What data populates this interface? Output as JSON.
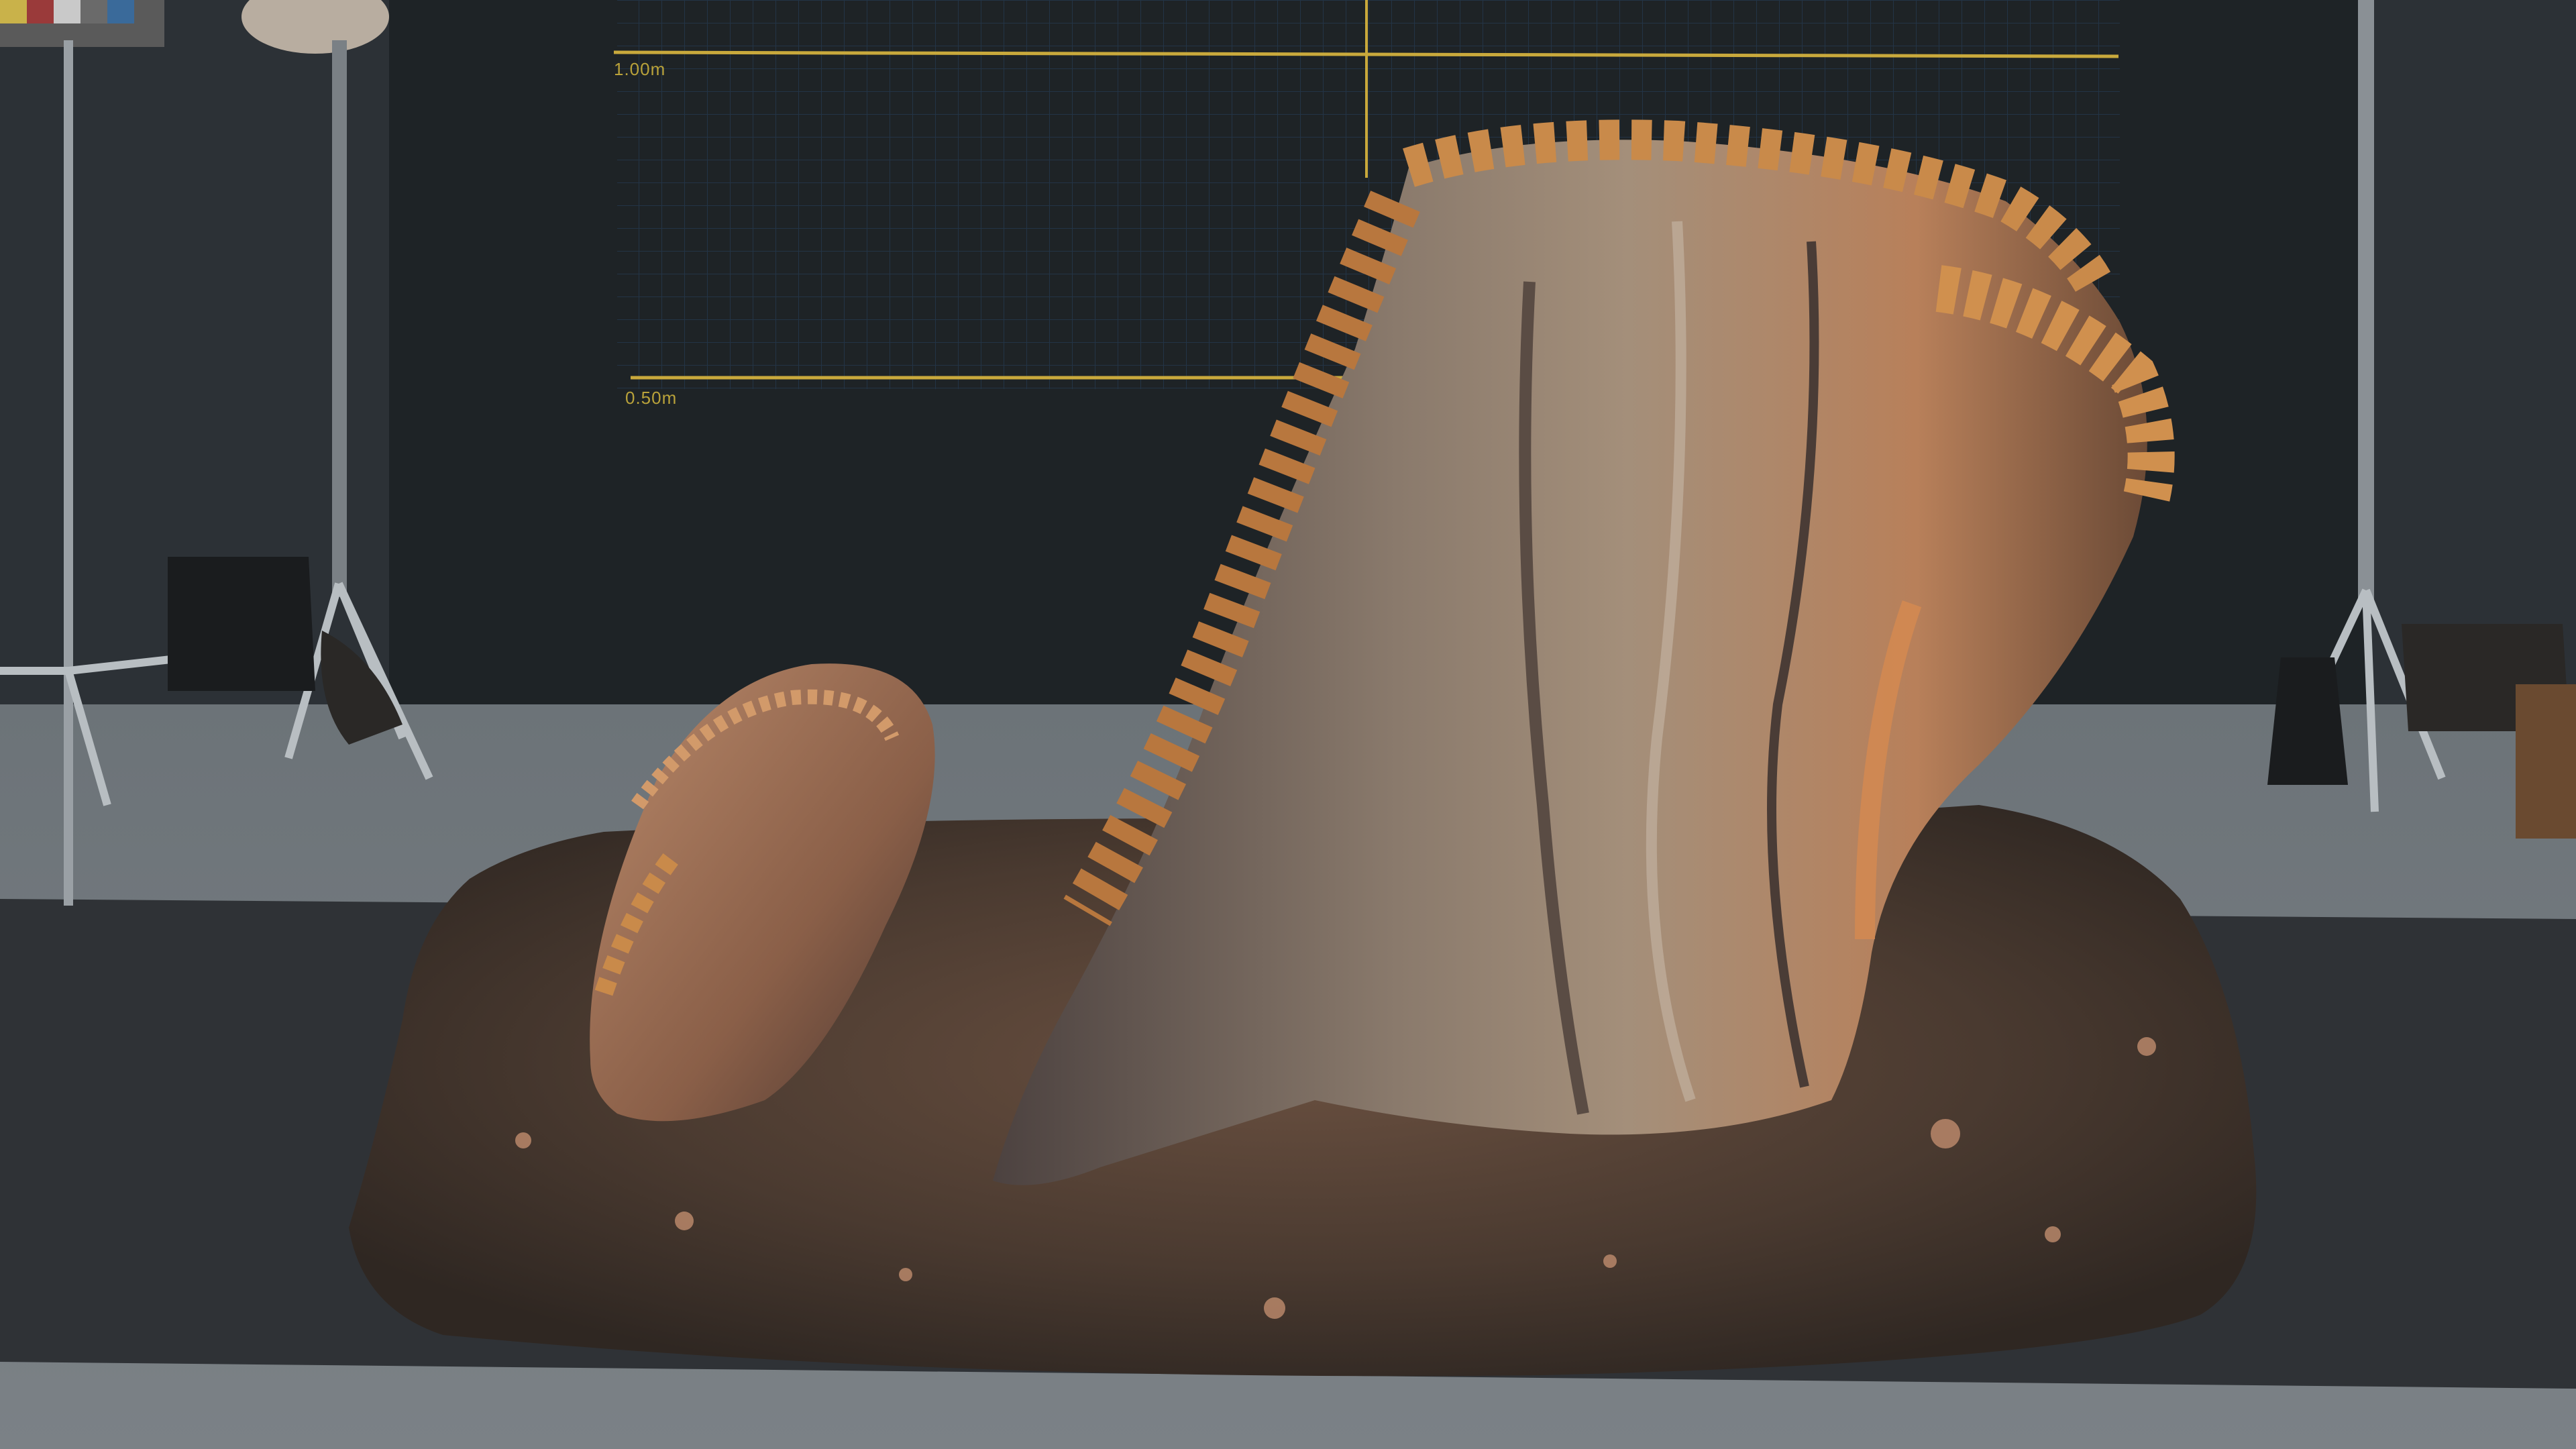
{
  "scene": {
    "description_free": true,
    "scale_labels": {
      "top": "1.00m",
      "middle": "0.50m"
    },
    "colors": {
      "backdrop": "#1f2326",
      "grid_line": "#24364a",
      "scale_line": "#c9a93c",
      "floor": "#6b7176",
      "mat": "#2f3236",
      "soil": "#4a3a30",
      "bark": "#6b5a4e",
      "fungus": "#c98a4a"
    }
  }
}
